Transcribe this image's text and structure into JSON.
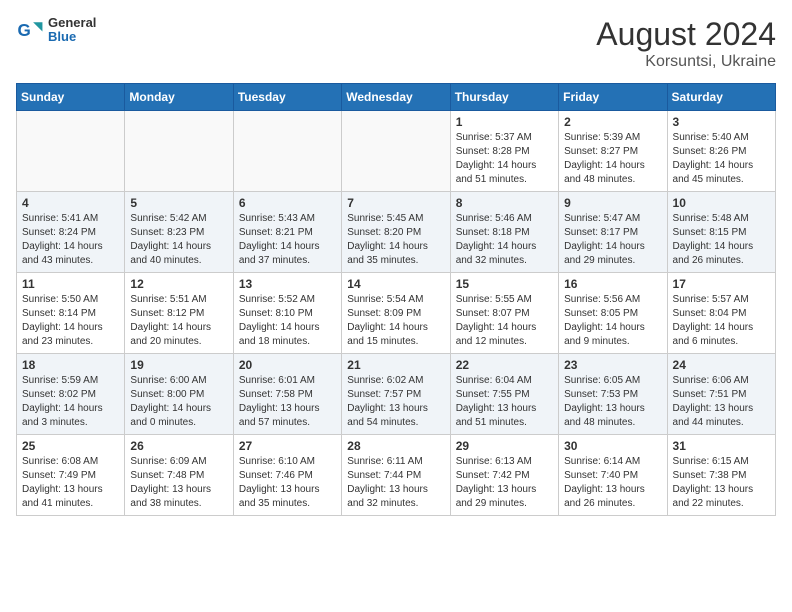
{
  "header": {
    "logo": {
      "general": "General",
      "blue": "Blue"
    },
    "title": "August 2024",
    "location": "Korsuntsi, Ukraine"
  },
  "calendar": {
    "headers": [
      "Sunday",
      "Monday",
      "Tuesday",
      "Wednesday",
      "Thursday",
      "Friday",
      "Saturday"
    ],
    "weeks": [
      [
        {
          "day": "",
          "info": ""
        },
        {
          "day": "",
          "info": ""
        },
        {
          "day": "",
          "info": ""
        },
        {
          "day": "",
          "info": ""
        },
        {
          "day": "1",
          "info": "Sunrise: 5:37 AM\nSunset: 8:28 PM\nDaylight: 14 hours\nand 51 minutes."
        },
        {
          "day": "2",
          "info": "Sunrise: 5:39 AM\nSunset: 8:27 PM\nDaylight: 14 hours\nand 48 minutes."
        },
        {
          "day": "3",
          "info": "Sunrise: 5:40 AM\nSunset: 8:26 PM\nDaylight: 14 hours\nand 45 minutes."
        }
      ],
      [
        {
          "day": "4",
          "info": "Sunrise: 5:41 AM\nSunset: 8:24 PM\nDaylight: 14 hours\nand 43 minutes."
        },
        {
          "day": "5",
          "info": "Sunrise: 5:42 AM\nSunset: 8:23 PM\nDaylight: 14 hours\nand 40 minutes."
        },
        {
          "day": "6",
          "info": "Sunrise: 5:43 AM\nSunset: 8:21 PM\nDaylight: 14 hours\nand 37 minutes."
        },
        {
          "day": "7",
          "info": "Sunrise: 5:45 AM\nSunset: 8:20 PM\nDaylight: 14 hours\nand 35 minutes."
        },
        {
          "day": "8",
          "info": "Sunrise: 5:46 AM\nSunset: 8:18 PM\nDaylight: 14 hours\nand 32 minutes."
        },
        {
          "day": "9",
          "info": "Sunrise: 5:47 AM\nSunset: 8:17 PM\nDaylight: 14 hours\nand 29 minutes."
        },
        {
          "day": "10",
          "info": "Sunrise: 5:48 AM\nSunset: 8:15 PM\nDaylight: 14 hours\nand 26 minutes."
        }
      ],
      [
        {
          "day": "11",
          "info": "Sunrise: 5:50 AM\nSunset: 8:14 PM\nDaylight: 14 hours\nand 23 minutes."
        },
        {
          "day": "12",
          "info": "Sunrise: 5:51 AM\nSunset: 8:12 PM\nDaylight: 14 hours\nand 20 minutes."
        },
        {
          "day": "13",
          "info": "Sunrise: 5:52 AM\nSunset: 8:10 PM\nDaylight: 14 hours\nand 18 minutes."
        },
        {
          "day": "14",
          "info": "Sunrise: 5:54 AM\nSunset: 8:09 PM\nDaylight: 14 hours\nand 15 minutes."
        },
        {
          "day": "15",
          "info": "Sunrise: 5:55 AM\nSunset: 8:07 PM\nDaylight: 14 hours\nand 12 minutes."
        },
        {
          "day": "16",
          "info": "Sunrise: 5:56 AM\nSunset: 8:05 PM\nDaylight: 14 hours\nand 9 minutes."
        },
        {
          "day": "17",
          "info": "Sunrise: 5:57 AM\nSunset: 8:04 PM\nDaylight: 14 hours\nand 6 minutes."
        }
      ],
      [
        {
          "day": "18",
          "info": "Sunrise: 5:59 AM\nSunset: 8:02 PM\nDaylight: 14 hours\nand 3 minutes."
        },
        {
          "day": "19",
          "info": "Sunrise: 6:00 AM\nSunset: 8:00 PM\nDaylight: 14 hours\nand 0 minutes."
        },
        {
          "day": "20",
          "info": "Sunrise: 6:01 AM\nSunset: 7:58 PM\nDaylight: 13 hours\nand 57 minutes."
        },
        {
          "day": "21",
          "info": "Sunrise: 6:02 AM\nSunset: 7:57 PM\nDaylight: 13 hours\nand 54 minutes."
        },
        {
          "day": "22",
          "info": "Sunrise: 6:04 AM\nSunset: 7:55 PM\nDaylight: 13 hours\nand 51 minutes."
        },
        {
          "day": "23",
          "info": "Sunrise: 6:05 AM\nSunset: 7:53 PM\nDaylight: 13 hours\nand 48 minutes."
        },
        {
          "day": "24",
          "info": "Sunrise: 6:06 AM\nSunset: 7:51 PM\nDaylight: 13 hours\nand 44 minutes."
        }
      ],
      [
        {
          "day": "25",
          "info": "Sunrise: 6:08 AM\nSunset: 7:49 PM\nDaylight: 13 hours\nand 41 minutes."
        },
        {
          "day": "26",
          "info": "Sunrise: 6:09 AM\nSunset: 7:48 PM\nDaylight: 13 hours\nand 38 minutes."
        },
        {
          "day": "27",
          "info": "Sunrise: 6:10 AM\nSunset: 7:46 PM\nDaylight: 13 hours\nand 35 minutes."
        },
        {
          "day": "28",
          "info": "Sunrise: 6:11 AM\nSunset: 7:44 PM\nDaylight: 13 hours\nand 32 minutes."
        },
        {
          "day": "29",
          "info": "Sunrise: 6:13 AM\nSunset: 7:42 PM\nDaylight: 13 hours\nand 29 minutes."
        },
        {
          "day": "30",
          "info": "Sunrise: 6:14 AM\nSunset: 7:40 PM\nDaylight: 13 hours\nand 26 minutes."
        },
        {
          "day": "31",
          "info": "Sunrise: 6:15 AM\nSunset: 7:38 PM\nDaylight: 13 hours\nand 22 minutes."
        }
      ]
    ]
  }
}
